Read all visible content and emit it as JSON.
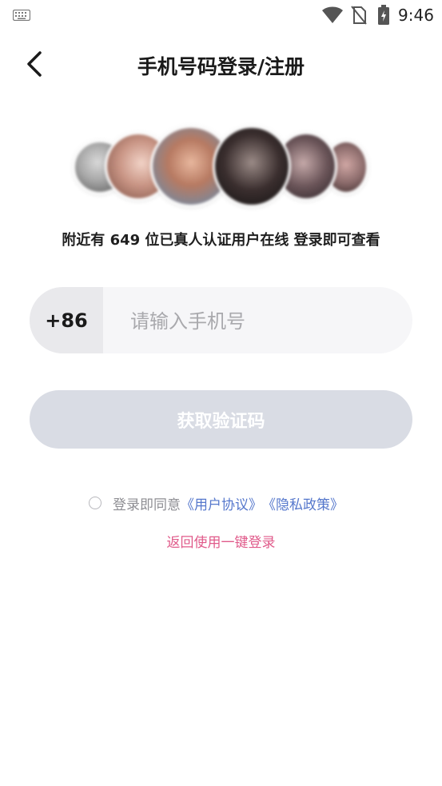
{
  "status_bar": {
    "time": "9:46",
    "icons": [
      "keyboard-icon",
      "wifi-icon",
      "no-sim-icon",
      "battery-charging-icon"
    ]
  },
  "header": {
    "title": "手机号码登录/注册",
    "back_icon": "chevron-left-icon"
  },
  "nearby": {
    "text": "附近有 649 位已真人认证用户在线 登录即可查看"
  },
  "phone": {
    "country_code": "+86",
    "placeholder": "请输入手机号",
    "value": ""
  },
  "code_button": {
    "label": "获取验证码"
  },
  "agreement": {
    "prefix": "登录即同意",
    "user_agreement": "《用户协议》",
    "privacy_policy": "《隐私政策》",
    "checked": false
  },
  "one_key_login": {
    "label": "返回使用一键登录"
  },
  "colors": {
    "accent_pink": "#e05a8a",
    "link_blue": "#5577cc",
    "button_disabled": "#d9dce4"
  }
}
